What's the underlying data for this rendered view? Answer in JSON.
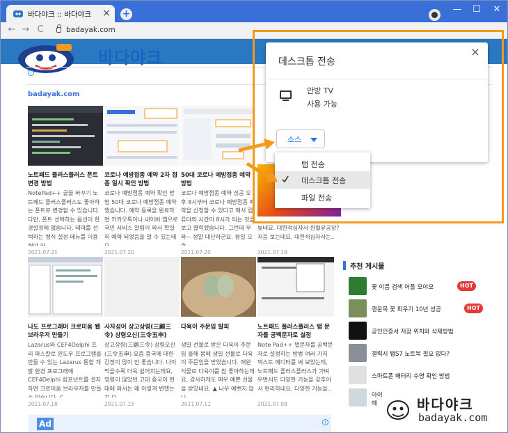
{
  "browser": {
    "tab_title": "바다야크 :: 바다야크",
    "tab_close": "×",
    "new_tab": "+",
    "url": "badayak.com",
    "win_min": "—",
    "win_max": "☐",
    "win_close": "✕",
    "nav_back": "←",
    "nav_forward": "→",
    "nav_reload": "C"
  },
  "site": {
    "brand": "바다야크",
    "domain": "badayak.com",
    "ad_info": "i",
    "bottom_ad_label": "Ad"
  },
  "posts": [
    {
      "title": "노트패드 플러스플러스 폰트 변경 방법",
      "desc": "NotePad++ 글꼴 바꾸기 노트패드 플러스플러스도 좋아하는 폰트로 변경할 수 있습니다. 다만, 폰트 선택하는 옵션이 한경설정에 없습니다. 테마를 선택하는 형식 설정 메뉴를 이용해야 하..",
      "date": "2021.07.21"
    },
    {
      "title": "코로나 예방접종 예약 2차 접종 일시 확인 방법",
      "desc": "코로나 예방접종 예약 확인 방법 50대 코로나 예방접종 예약했습니다. 예약 등록을 완료하면 카카오톡이나 네이버 앱으로 국민 서비스 알림이 와서 확실히 예약 되었음을 알 수 있는데요,..",
      "date": "2021.07.20"
    },
    {
      "title": "50대 코로나 예방접종 예약 방법",
      "desc": "코로나 예방접종 예약 성공 오후 8시부터 코로나 예방접종 예약을 신청할 수 있다고 해서 컴퓨터의 시간이 8시가 되는 것을 보고 클릭했습니다. 그런데 우와~ 정말 대단하군요. 평일 오후..",
      "date": "2021.07.20"
    },
    {
      "title_tail": "",
      "desc": "늦네요. 대한적십자사 헌혈유공장? 처음 보는데요, 대한적십자사는..",
      "date": "2021.07.19"
    },
    {
      "title": "나도 프로그래머 크로미움 웹 브라우저 만들기",
      "desc": "Lazarus와 CEF4Delphi 프리 파스칼로 윈도우 프로그램을 만들 수 있는 Lazarus 통합 개발 환경 프로그래에 CEF4Delphi 컴포넌트를 설치하면 크로미움 브라우저를 만들 수 있습니다. C..",
      "date": "2021.07.18"
    },
    {
      "title": "사자성어 상고상령(三顧三令) 상령오신(三令五申)",
      "desc": "상고상령(三顧三令) 상령오신(三令五申) 요즘 중국에 대한 감정이 많이 안 좋습니다. 나이 먹을수록 더욱 싫어지는데요, 명령이 많았던 고대 중국이 현대에 와서는 왜 이렇게 변했는지 모..",
      "date": "2021.07.15"
    },
    {
      "title": "다육이 주문입 탈피",
      "desc": "생일 선물로 받은 다육이 주문입 올해 봄에 생일 선물로 다육이 주문입을 받았습니다. 애완식물로 다육이를 참 좋아하는데요, 감사하게도 매우 예쁜 선물을 받았네요. ▲ 너무 예쁘지 않나..",
      "date": "2021.07.11"
    },
    {
      "title": "노트패드 플러스플러스 탭 문자를 공백문자로 설정",
      "desc": "Note Pad++ 탭문자를 공백문자로 설정하는 방법 여러 가지 텍스트 에디터를 써 보았는데, 노트패드 플러스플러스가 가벼우면서도 다양한 기능을 갖추어서 편리하네요. 다양한 기능을..",
      "date": "2021.07.08"
    }
  ],
  "sidebar": {
    "heading": "추천 게시물",
    "items": [
      {
        "label": "꽃 이름 검색 어플 모야모",
        "hot": "HOT"
      },
      {
        "label": "행운목 꽃 피우기 10년 성공",
        "hot": "HOT"
      },
      {
        "label": "공인인증서 저장 위치와 삭제방법",
        "hot": ""
      },
      {
        "label": "갤럭시 탭S7 노트북 필요 없다?",
        "hot": ""
      },
      {
        "label": "스마트폰 배터리 수명 확인 방법",
        "hot": ""
      },
      {
        "label": "아이",
        "hot": ""
      },
      {
        "label": "때",
        "hot": ""
      }
    ]
  },
  "cast_dialog": {
    "title": "데스크톱 전송",
    "close": "×",
    "device_name": "안방 TV",
    "device_status": "사용 가능",
    "source_label": "소스"
  },
  "source_menu": {
    "items": [
      {
        "label": "탭 전송",
        "selected": false
      },
      {
        "label": "데스크톱 전송",
        "selected": true
      },
      {
        "label": "파일 전송",
        "selected": false
      }
    ]
  },
  "watermark": {
    "brand": "바다야크",
    "domain": "badayak.com"
  },
  "colors": {
    "highlight": "#f39a1d",
    "chrome_blue": "#3b6fd8",
    "link_blue": "#1a73e8",
    "hot_red": "#e53935"
  }
}
